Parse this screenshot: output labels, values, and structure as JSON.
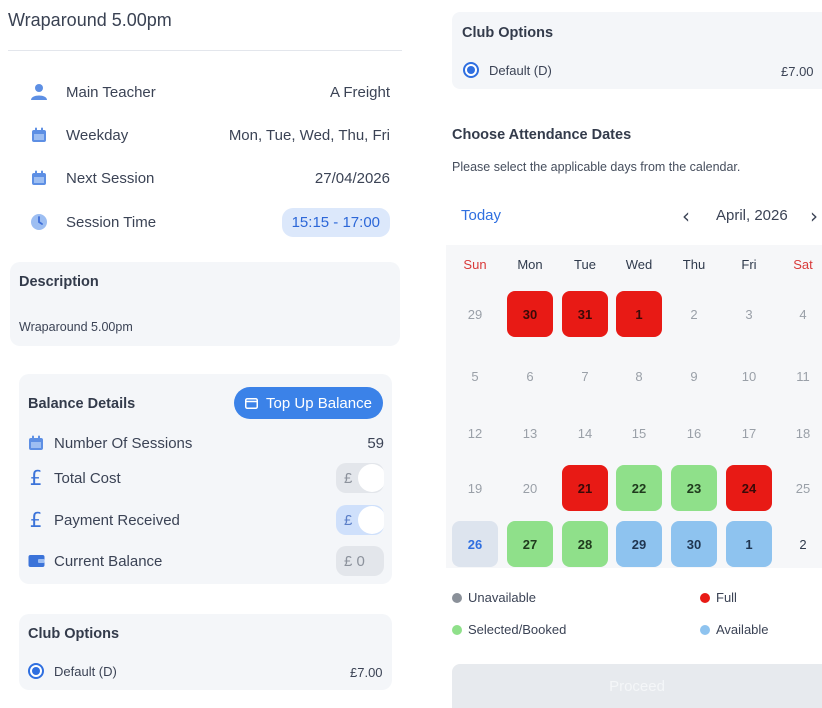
{
  "header": {
    "title": "Wraparound 5.00pm"
  },
  "details": [
    {
      "icon": "person-icon",
      "label": "Main Teacher",
      "value": "A Freight"
    },
    {
      "icon": "calendar-icon",
      "label": "Weekday",
      "value": "Mon, Tue, Wed, Thu, Fri"
    },
    {
      "icon": "calendar-icon",
      "label": "Next Session",
      "value": "27/04/2026"
    },
    {
      "icon": "clock-icon",
      "label": "Session Time",
      "value": "15:15 - 17:00"
    }
  ],
  "description": {
    "heading": "Description",
    "text": "Wraparound 5.00pm"
  },
  "balance": {
    "heading": "Balance Details",
    "topup_label": "Top Up Balance",
    "rows": [
      {
        "icon": "calendar-icon",
        "label": "Number Of Sessions",
        "value": "59"
      },
      {
        "icon": "pound-icon",
        "label": "Total Cost",
        "value": "£"
      },
      {
        "icon": "pound-icon",
        "label": "Payment Received",
        "value": "£"
      },
      {
        "icon": "wallet-icon",
        "label": "Current Balance",
        "value": "£ 0"
      }
    ]
  },
  "club_options": {
    "heading": "Club Options",
    "option_label": "Default (D)",
    "option_price": "£7.00"
  },
  "attendance": {
    "title": "Choose Attendance Dates",
    "subtitle": "Please select the applicable days from the calendar.",
    "today_label": "Today",
    "month_label": "April, 2026",
    "prev_icon": "chevron-left-icon",
    "next_icon": "chevron-right-icon"
  },
  "calendar": {
    "weekdays": [
      "Sun",
      "Mon",
      "Tue",
      "Wed",
      "Thu",
      "Fri",
      "Sat"
    ],
    "weeks": [
      [
        {
          "d": "29",
          "s": "past"
        },
        {
          "d": "30",
          "s": "full"
        },
        {
          "d": "31",
          "s": "full"
        },
        {
          "d": "1",
          "s": "full"
        },
        {
          "d": "2",
          "s": "past"
        },
        {
          "d": "3",
          "s": "past"
        },
        {
          "d": "4",
          "s": "past"
        }
      ],
      [
        {
          "d": "5",
          "s": "past"
        },
        {
          "d": "6",
          "s": "past"
        },
        {
          "d": "7",
          "s": "past"
        },
        {
          "d": "8",
          "s": "past"
        },
        {
          "d": "9",
          "s": "past"
        },
        {
          "d": "10",
          "s": "past"
        },
        {
          "d": "11",
          "s": "past"
        }
      ],
      [
        {
          "d": "12",
          "s": "past"
        },
        {
          "d": "13",
          "s": "past"
        },
        {
          "d": "14",
          "s": "past"
        },
        {
          "d": "15",
          "s": "past"
        },
        {
          "d": "16",
          "s": "past"
        },
        {
          "d": "17",
          "s": "past"
        },
        {
          "d": "18",
          "s": "past"
        }
      ],
      [
        {
          "d": "19",
          "s": "past"
        },
        {
          "d": "20",
          "s": "past"
        },
        {
          "d": "21",
          "s": "full"
        },
        {
          "d": "22",
          "s": "booked"
        },
        {
          "d": "23",
          "s": "booked"
        },
        {
          "d": "24",
          "s": "full"
        },
        {
          "d": "25",
          "s": "past"
        }
      ],
      [
        {
          "d": "26",
          "s": "today"
        },
        {
          "d": "27",
          "s": "booked"
        },
        {
          "d": "28",
          "s": "booked"
        },
        {
          "d": "29",
          "s": "available"
        },
        {
          "d": "30",
          "s": "available"
        },
        {
          "d": "1",
          "s": "available"
        },
        {
          "d": "2",
          "s": "next-month"
        }
      ]
    ]
  },
  "legend": [
    {
      "label": "Unavailable",
      "color": "#8a9099"
    },
    {
      "label": "Full",
      "color": "#e81a15"
    },
    {
      "label": "Selected/Booked",
      "color": "#8fe08a"
    },
    {
      "label": "Available",
      "color": "#8ec3ef"
    }
  ],
  "proceed_label": "Proceed"
}
